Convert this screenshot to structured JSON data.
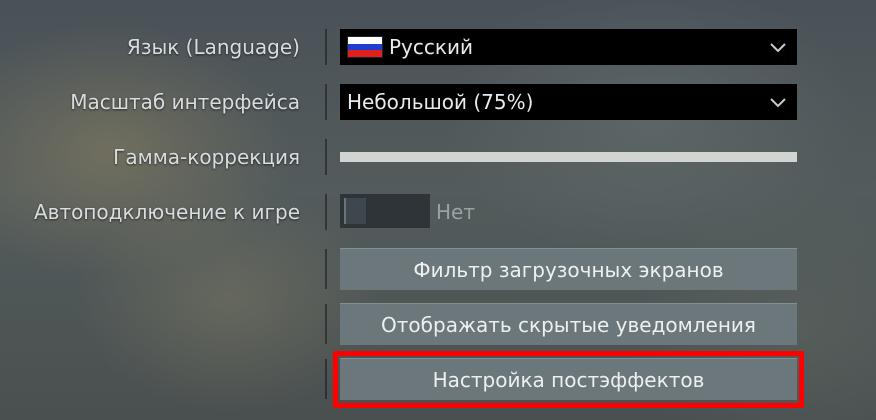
{
  "settings": {
    "language": {
      "label": "Язык (Language)",
      "value": "Русский",
      "flag_colors": [
        "#ffffff",
        "#1c3fd0",
        "#e0201e"
      ]
    },
    "ui_scale": {
      "label": "Масштаб интерфейса",
      "value": "Небольшой (75%)"
    },
    "gamma": {
      "label": "Гамма-коррекция"
    },
    "auto_connect": {
      "label": "Автоподключение к игре",
      "state_text": "Нет",
      "enabled": false
    }
  },
  "buttons": {
    "loading_screen_filter": "Фильтр загрузочных экранов",
    "show_hidden_notifications": "Отображать скрытые уведомления",
    "postfx_settings": "Настройка постэффектов"
  },
  "highlight_color": "#ff0000",
  "icons": {
    "dropdown": "chevron-down-icon",
    "flag": "russia-flag-icon"
  }
}
